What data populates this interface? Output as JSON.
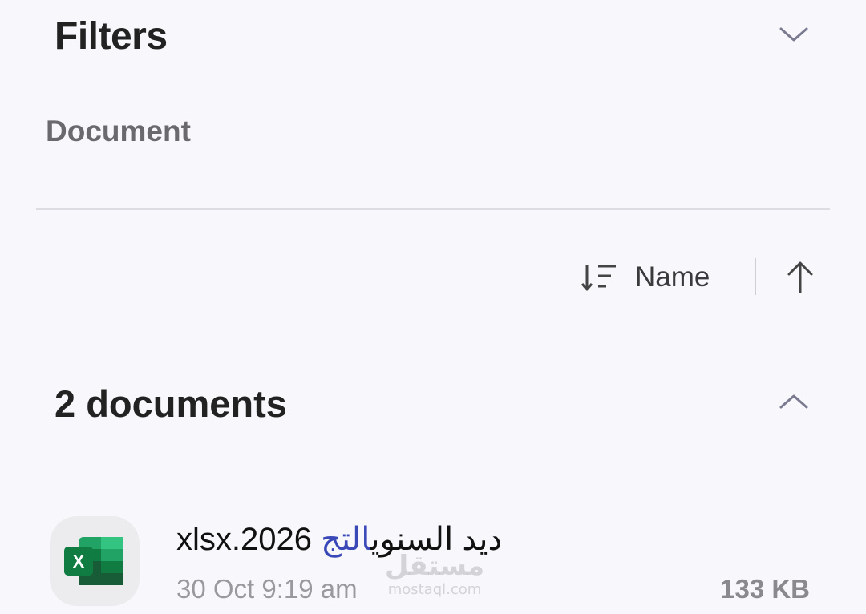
{
  "header": {
    "title": "Filters",
    "collapse_icon": "chevron-down-icon"
  },
  "filters": {
    "chips": [
      {
        "label": "Document"
      }
    ]
  },
  "sort": {
    "icon": "sort-lines-icon",
    "label": "Name",
    "direction_icon": "arrow-up-icon"
  },
  "group": {
    "title": "2 documents",
    "collapse_icon": "chevron-up-icon"
  },
  "files": [
    {
      "name_prefix": "xlsx.2026 ",
      "name_middle": "ديد السنوي",
      "name_highlight": "التج",
      "date": "30 Oct 9:19 am",
      "size": "133 KB",
      "icon": "excel-icon",
      "icon_letter": "X"
    }
  ],
  "watermark": {
    "text": "مستقل",
    "sub": "mostaql.com"
  },
  "colors": {
    "background": "#f8f8fc",
    "accent": "#3b49b8",
    "excel_green": "#1e7145"
  }
}
